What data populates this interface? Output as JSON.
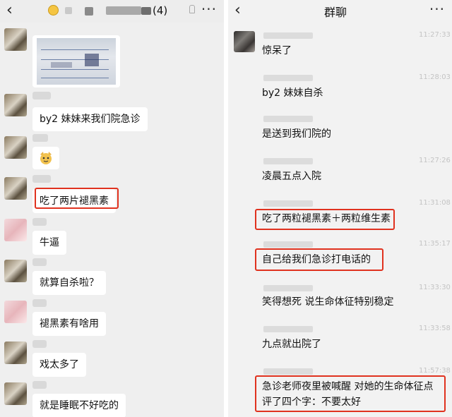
{
  "left": {
    "title_count": "(4)",
    "messages": [
      {
        "text": "by2 妹妹来我们院急诊"
      },
      {
        "text": "吃了两片褪黑素"
      },
      {
        "text": "牛逼"
      },
      {
        "text": "就算自杀啦？"
      },
      {
        "text": "褪黑素有啥用"
      },
      {
        "text": "戏太多了"
      },
      {
        "text": "就是睡眠不好吃的"
      }
    ]
  },
  "right": {
    "title": "群聊",
    "timestamps": [
      "11:27:33",
      "11:28:03",
      "11:27:26",
      "11:31:08",
      "11:35:17",
      "11:33:30",
      "11:33:58",
      "11:57:38"
    ],
    "messages": [
      {
        "text": "惊呆了"
      },
      {
        "text": "by2 妹妹自杀"
      },
      {
        "text": "是送到我们院的"
      },
      {
        "text": "凌晨五点入院"
      },
      {
        "text": "吃了两粒褪黑素＋两粒维生素"
      },
      {
        "text": "自己给我们急诊打电话的"
      },
      {
        "text": "笑得想死 说生命体征特别稳定"
      },
      {
        "text": "九点就出院了"
      },
      {
        "text": "急诊老师夜里被喊醒 对她的生命体征点"
      },
      {
        "text": "评了四个字：不要太好"
      }
    ]
  },
  "colors": {
    "highlight": "#e0321f",
    "bubble": "#ffffff",
    "chat_bg": "#efefef"
  }
}
